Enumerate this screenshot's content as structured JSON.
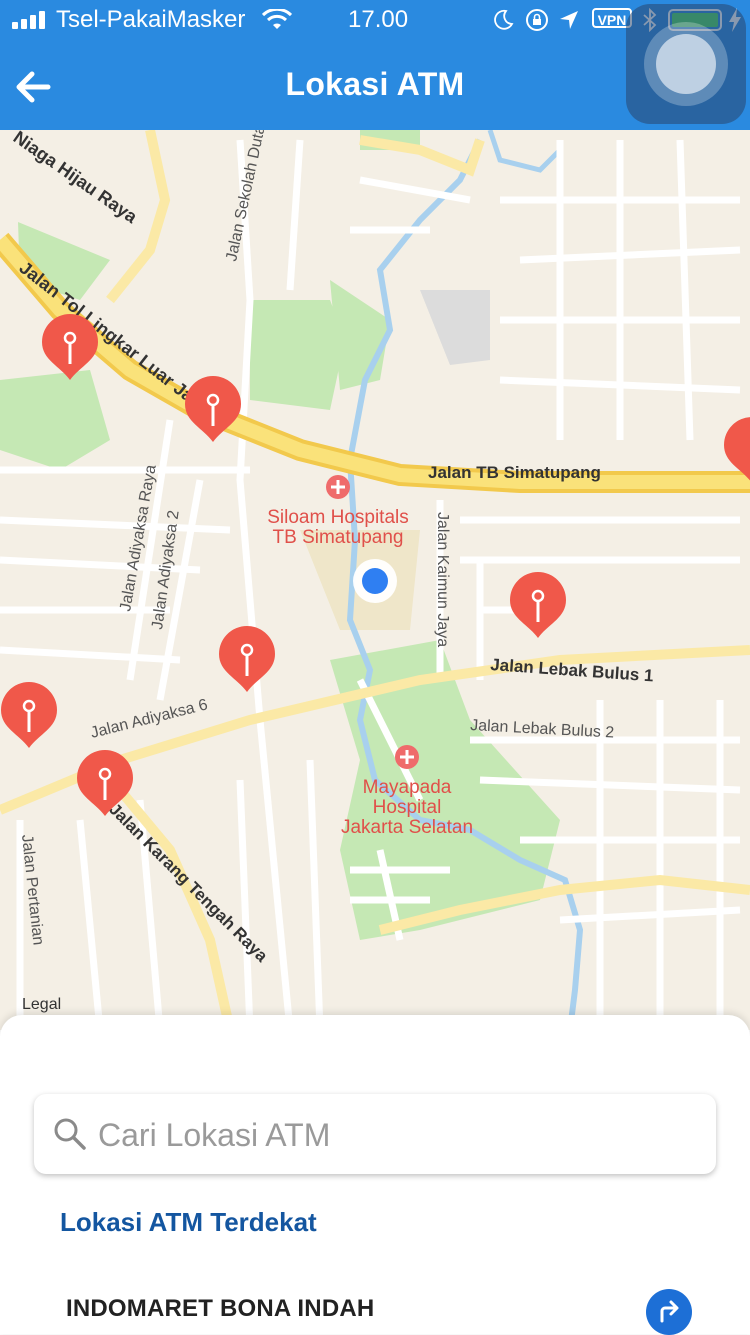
{
  "status_bar": {
    "carrier": "Tsel-PakaiMasker",
    "time": "17.00",
    "vpn": "VPN",
    "icons": [
      "signal-icon",
      "wifi-icon",
      "moon-icon",
      "rotation-lock-icon",
      "location-arrow-icon",
      "bluetooth-icon",
      "battery-icon",
      "charging-icon"
    ]
  },
  "nav": {
    "title": "Lokasi ATM",
    "back_icon": "arrow-left-icon"
  },
  "map": {
    "labels": {
      "road_niaga": "Niaga Hijau Raya",
      "road_tol": "Jalan Tol Lingkar Luar Jakarta",
      "road_sekolah": "Jalan Sekolah Duta",
      "road_tb": "Jalan TB Simatupang",
      "road_adiyaksa_raya": "Jalan Adiyaksa Raya",
      "road_adiyaksa2": "Jalan Adiyaksa 2",
      "road_kaimun": "Jalan Kaimun Jaya",
      "road_lebak1": "Jalan Lebak Bulus 1",
      "road_lebak2": "Jalan Lebak Bulus 2",
      "road_adiyaksa6": "Jalan Adiyaksa 6",
      "road_karang": "Jalan Karang Tengah Raya",
      "road_pertanian": "Jalan Pertanian",
      "siloam_1": "Siloam Hospitals",
      "siloam_2": "TB Simatupang",
      "mayapada_1": "Mayapada",
      "mayapada_2": "Hospital",
      "mayapada_3": "Jakarta Selatan",
      "legal": "Legal"
    },
    "atm_pin_count": 7,
    "colors": {
      "pin": "#f0584a",
      "user_location": "#2f7ff2",
      "highway": "#f7d94c",
      "park": "#c5e8b4",
      "water": "#a8d0ee"
    }
  },
  "sheet": {
    "search_placeholder": "Cari Lokasi ATM",
    "search_icon": "search-icon",
    "section_title": "Lokasi ATM Terdekat",
    "atm_list": [
      {
        "name": "INDOMARET BONA INDAH",
        "action_icon": "directions-icon"
      }
    ]
  }
}
